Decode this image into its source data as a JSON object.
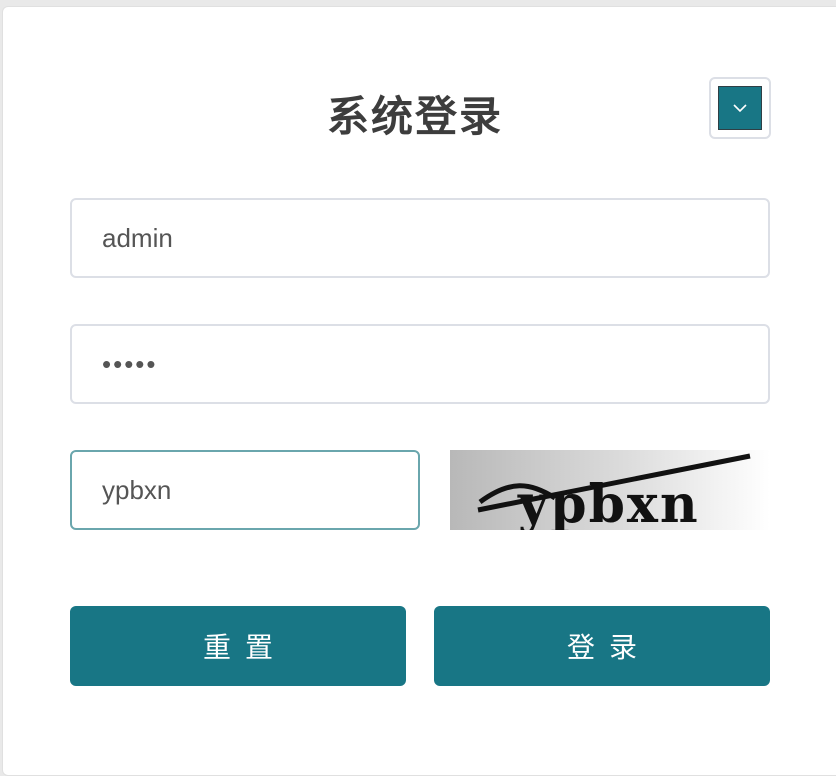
{
  "title": "系统登录",
  "language_toggle": {
    "icon": "chevron-down-icon"
  },
  "form": {
    "username": {
      "value": "admin",
      "placeholder": ""
    },
    "password": {
      "value": "•••••",
      "placeholder": ""
    },
    "captcha_input": {
      "value": "ypbxn",
      "placeholder": ""
    },
    "captcha_image_text": "ypbxn"
  },
  "buttons": {
    "reset_label": "重置",
    "login_label": "登录"
  },
  "colors": {
    "accent": "#187685",
    "border": "#dcdfe6",
    "focus_border": "#6aa6ad",
    "title": "#3d3d3d"
  }
}
